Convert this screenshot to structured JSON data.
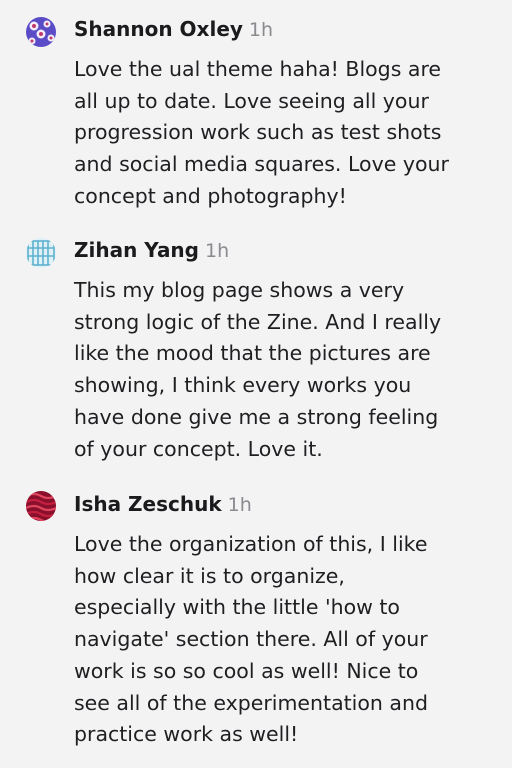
{
  "comments": [
    {
      "author": "Shannon Oxley",
      "time": "1h",
      "lines": [
        "Love the ual theme haha! Blogs are",
        "all up to date. Love seeing all your",
        "progression work such as test shots",
        "and social media squares. Love your",
        "concept and photography!"
      ]
    },
    {
      "author": "Zihan Yang",
      "time": "1h",
      "lines": [
        "This my blog page shows a very",
        "strong logic of the Zine. And I really",
        "like the mood that the pictures are",
        "showing, I think every works you",
        "have done give me a strong feeling",
        "of your concept. Love it."
      ]
    },
    {
      "author": "Isha Zeschuk",
      "time": "1h",
      "lines": [
        "Love the organization of this, I like",
        "how clear it is to organize,",
        "especially with the little 'how to",
        "navigate' section there. All of your",
        "work is so so cool as well! Nice to",
        "see all of the experimentation and",
        "practice work as well!"
      ]
    }
  ],
  "colors": {
    "background": "#f3f3f4",
    "author": "#1b1b1d",
    "time": "#8a8a8f",
    "text": "#1f1f22"
  },
  "icons": {
    "avatar_1": "purple-flower-pattern-avatar",
    "avatar_2": "blue-grid-pattern-avatar",
    "avatar_3": "red-wave-pattern-avatar"
  }
}
